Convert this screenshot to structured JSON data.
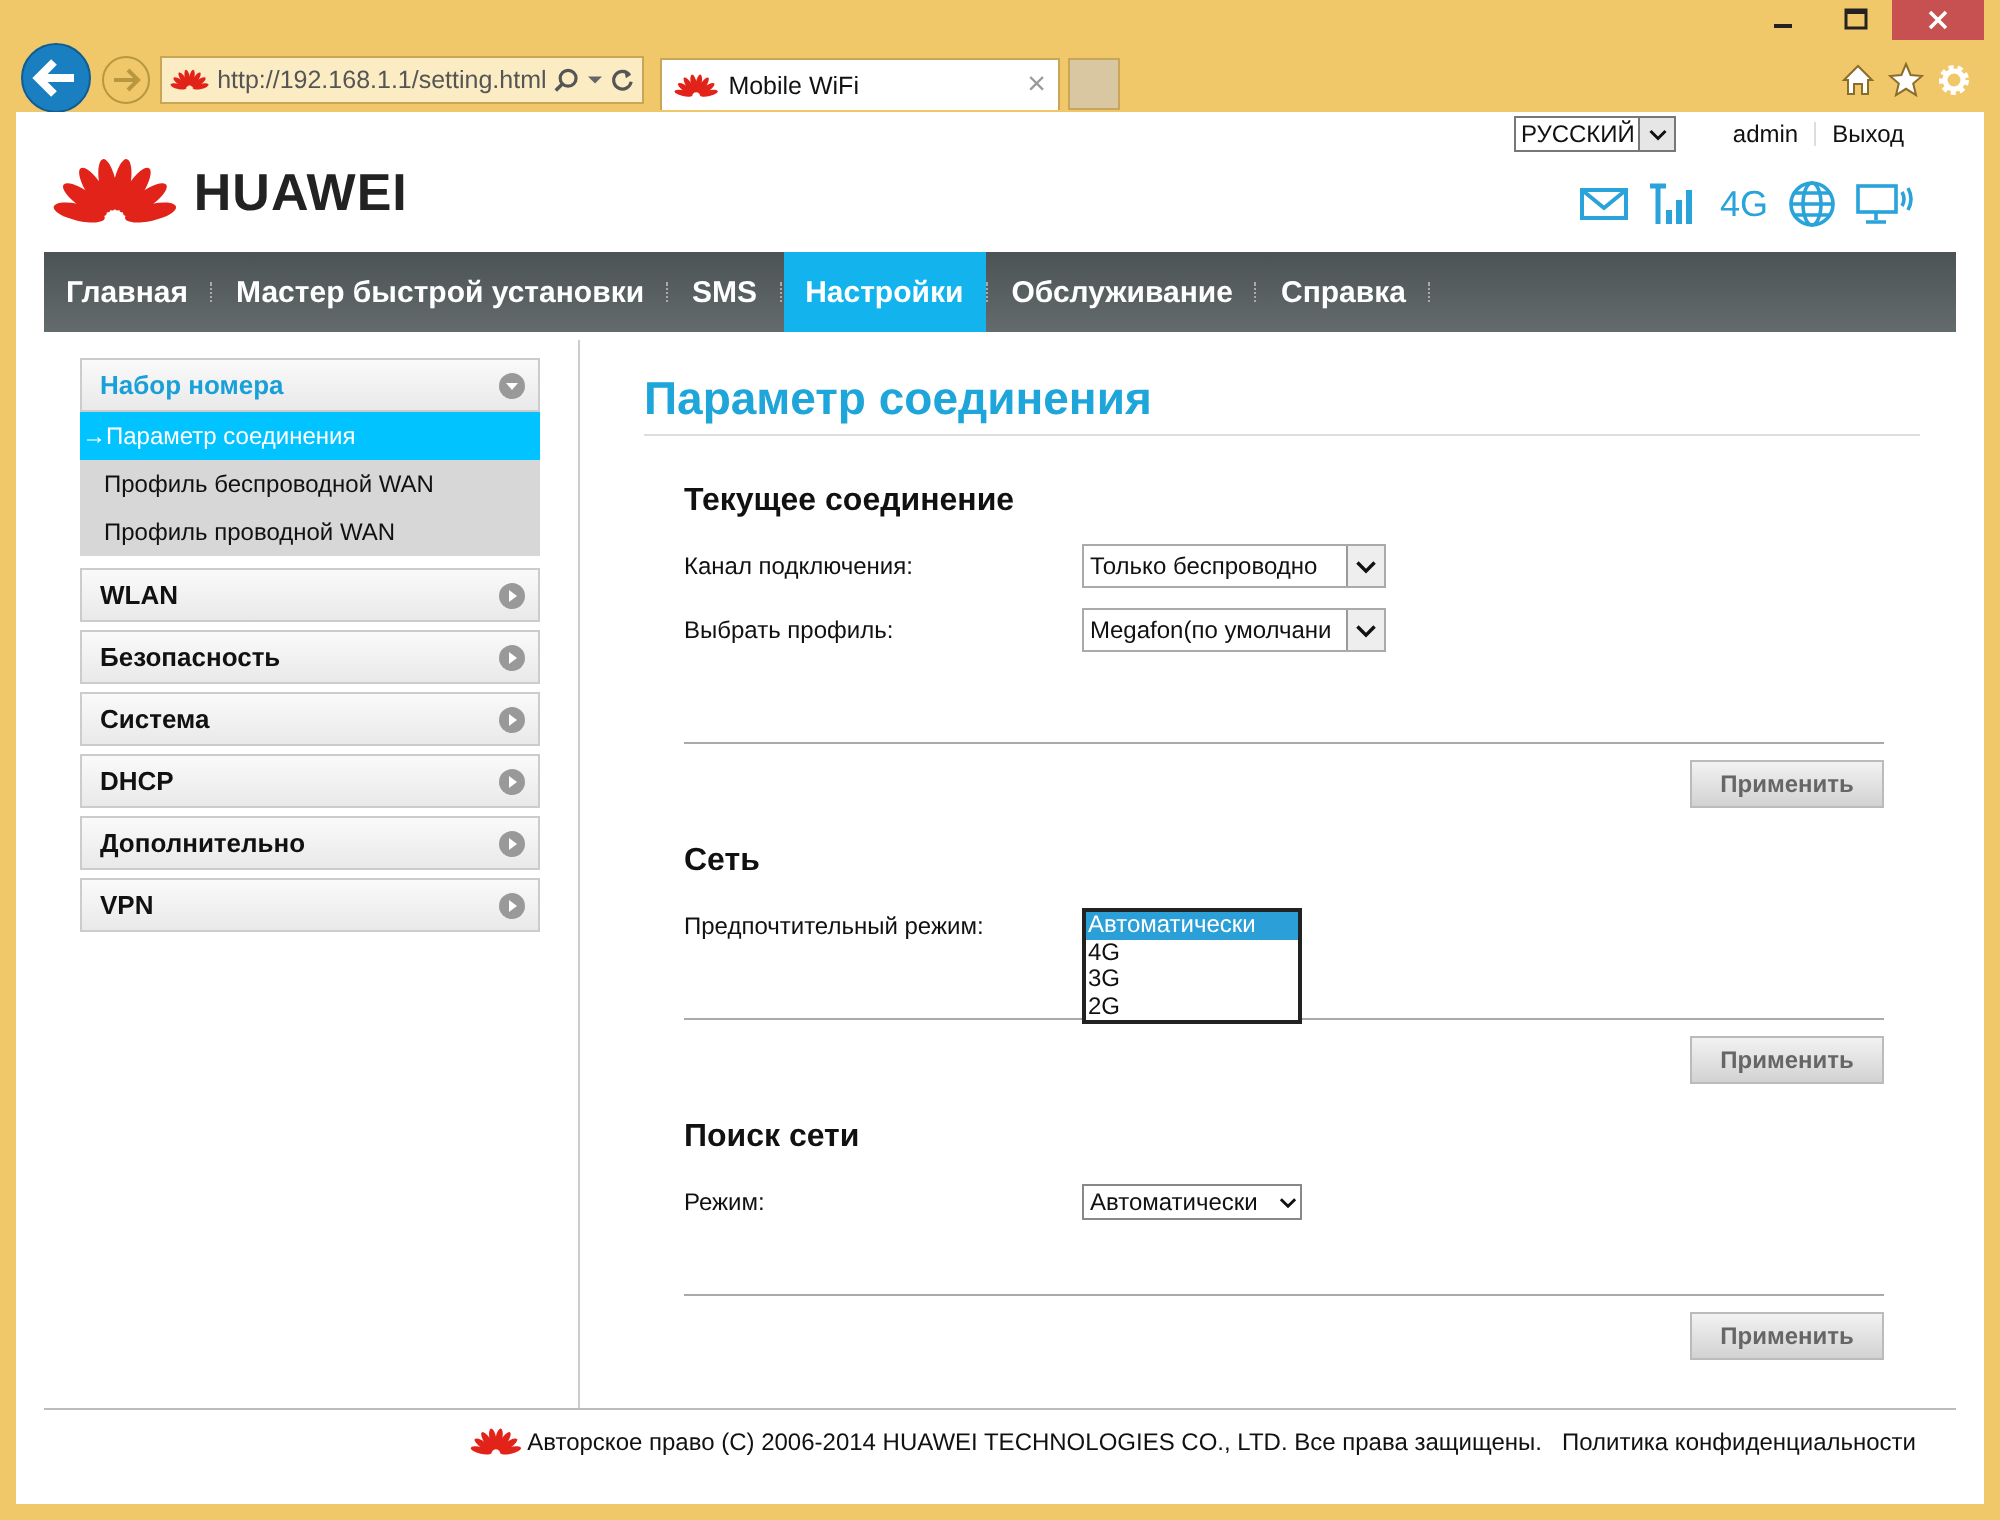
{
  "browser": {
    "address": "http://192.168.1.1/setting.html",
    "tab": {
      "title": "Mobile WiFi",
      "close": "×"
    }
  },
  "header": {
    "logo_text": "HUAWEI",
    "language": "РУССКИЙ",
    "user": "admin",
    "logout": "Выход",
    "network_type": "4G"
  },
  "nav": [
    {
      "label": "Главная",
      "selected": false
    },
    {
      "label": "Мастер быстрой установки",
      "selected": false
    },
    {
      "label": "SMS",
      "selected": false
    },
    {
      "label": "Настройки",
      "selected": true
    },
    {
      "label": "Обслуживание",
      "selected": false
    },
    {
      "label": "Справка",
      "selected": false
    }
  ],
  "sidebar": [
    {
      "label": "Набор номера",
      "expanded": true,
      "children": [
        {
          "label": "→Параметр соединения",
          "selected": true
        },
        {
          "label": "Профиль беспроводной WAN",
          "selected": false
        },
        {
          "label": "Профиль проводной WAN",
          "selected": false
        }
      ]
    },
    {
      "label": "WLAN",
      "expanded": false
    },
    {
      "label": "Безопасность",
      "expanded": false
    },
    {
      "label": "Система",
      "expanded": false
    },
    {
      "label": "DHCP",
      "expanded": false
    },
    {
      "label": "Дополнительно",
      "expanded": false
    },
    {
      "label": "VPN",
      "expanded": false
    }
  ],
  "page_title": "Параметр соединения",
  "sections": [
    {
      "title": "Текущее соединение",
      "fields": [
        {
          "kind": "select",
          "label": "Канал подключения:",
          "value": "Только беспроводно"
        },
        {
          "kind": "select",
          "label": "Выбрать профиль:",
          "value": "Megafon(по умолчани"
        }
      ],
      "button": "Применить"
    },
    {
      "title": "Сеть",
      "fields": [
        {
          "kind": "open_list",
          "label": "Предпочтительный режим:",
          "options": [
            {
              "label": "Автоматически",
              "selected": true
            },
            {
              "label": "4G",
              "selected": false
            },
            {
              "label": "3G",
              "selected": false
            },
            {
              "label": "2G",
              "selected": false
            }
          ]
        }
      ],
      "button": "Применить"
    },
    {
      "title": "Поиск сети",
      "fields": [
        {
          "kind": "flat_select",
          "label": "Режим:",
          "value": "Автоматически"
        }
      ],
      "button": "Применить"
    }
  ],
  "footer": {
    "copyright": "Авторское право (C) 2006-2014 HUAWEI TECHNOLOGIES CO., LTD. Все права защищены.",
    "privacy": "Политика конфиденциальности"
  }
}
